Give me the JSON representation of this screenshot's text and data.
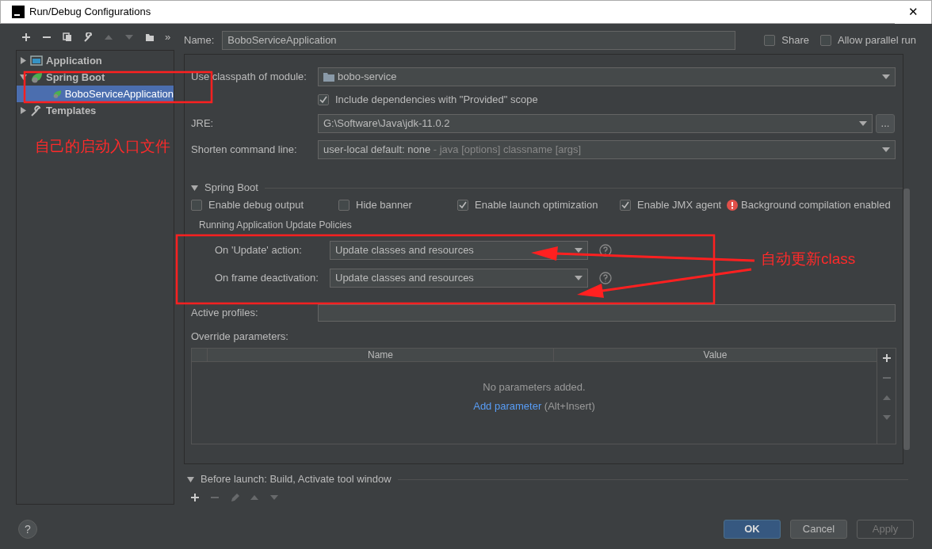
{
  "window": {
    "title": "Run/Debug Configurations",
    "close": "✕"
  },
  "toolbar": [
    {
      "disabled": false
    },
    {
      "disabled": false
    },
    {
      "disabled": false
    },
    {
      "disabled": false
    },
    {
      "disabled": true
    },
    {
      "disabled": true
    },
    {
      "disabled": false
    }
  ],
  "toolbar_more": "»",
  "tree": [
    {
      "label": "Application",
      "expanded": false,
      "selected": false
    },
    {
      "label": "Spring Boot",
      "expanded": true,
      "selected": false,
      "children": [
        {
          "label": "BoboServiceApplication",
          "selected": true
        }
      ]
    },
    {
      "label": "Templates",
      "expanded": false,
      "selected": false
    }
  ],
  "name": {
    "label": "Name:",
    "value": "BoboServiceApplication"
  },
  "share": {
    "label": "Share",
    "checked": false
  },
  "parallel": {
    "label": "Allow parallel run",
    "checked": false
  },
  "module": {
    "label": "Use classpath of module:",
    "value": "bobo-service"
  },
  "include_deps": {
    "label": "Include dependencies with \"Provided\" scope",
    "checked": true
  },
  "jre": {
    "label": "JRE:",
    "value": "G:\\Software\\Java\\jdk-11.0.2",
    "browse": "..."
  },
  "shorten": {
    "label": "Shorten command line:",
    "value": "user-local default: none",
    "hint": " - java [options] classname [args]"
  },
  "spring_boot": {
    "title": "Spring Boot",
    "expanded": true,
    "options": [
      {
        "label": "Enable debug output",
        "checked": false
      },
      {
        "label": "Hide banner",
        "checked": false
      },
      {
        "label": "Enable launch optimization",
        "checked": true
      },
      {
        "label": "Enable JMX agent",
        "checked": true
      }
    ],
    "warning": "Background compilation enabled"
  },
  "policies": {
    "title": "Running Application Update Policies",
    "rows": [
      {
        "label": "On 'Update' action:",
        "value": "Update classes and resources"
      },
      {
        "label": "On frame deactivation:",
        "value": "Update classes and resources"
      }
    ]
  },
  "active_profiles": {
    "label": "Active profiles:"
  },
  "override": {
    "label": "Override parameters:",
    "columns": [
      "Name",
      "Value"
    ],
    "empty": "No parameters added.",
    "link": "Add parameter",
    "shortcut": " (Alt+Insert)",
    "side_toolbar": [
      {
        "disabled": false
      },
      {
        "disabled": true
      },
      {
        "disabled": true
      },
      {
        "disabled": true
      }
    ]
  },
  "before_launch": {
    "title": "Before launch: Build, Activate tool window",
    "expanded": true,
    "toolbar": [
      {
        "disabled": false
      },
      {
        "disabled": true
      },
      {
        "disabled": true
      },
      {
        "disabled": true
      },
      {
        "disabled": true
      }
    ]
  },
  "help": "?",
  "buttons": [
    {
      "label": "OK",
      "kind": "primary",
      "disabled": false
    },
    {
      "label": "Cancel",
      "kind": "normal",
      "disabled": false
    },
    {
      "label": "Apply",
      "kind": "normal",
      "disabled": true
    }
  ],
  "annotations": [
    {
      "text": "自己的启动入口文件"
    },
    {
      "text": "自动更新class"
    }
  ]
}
